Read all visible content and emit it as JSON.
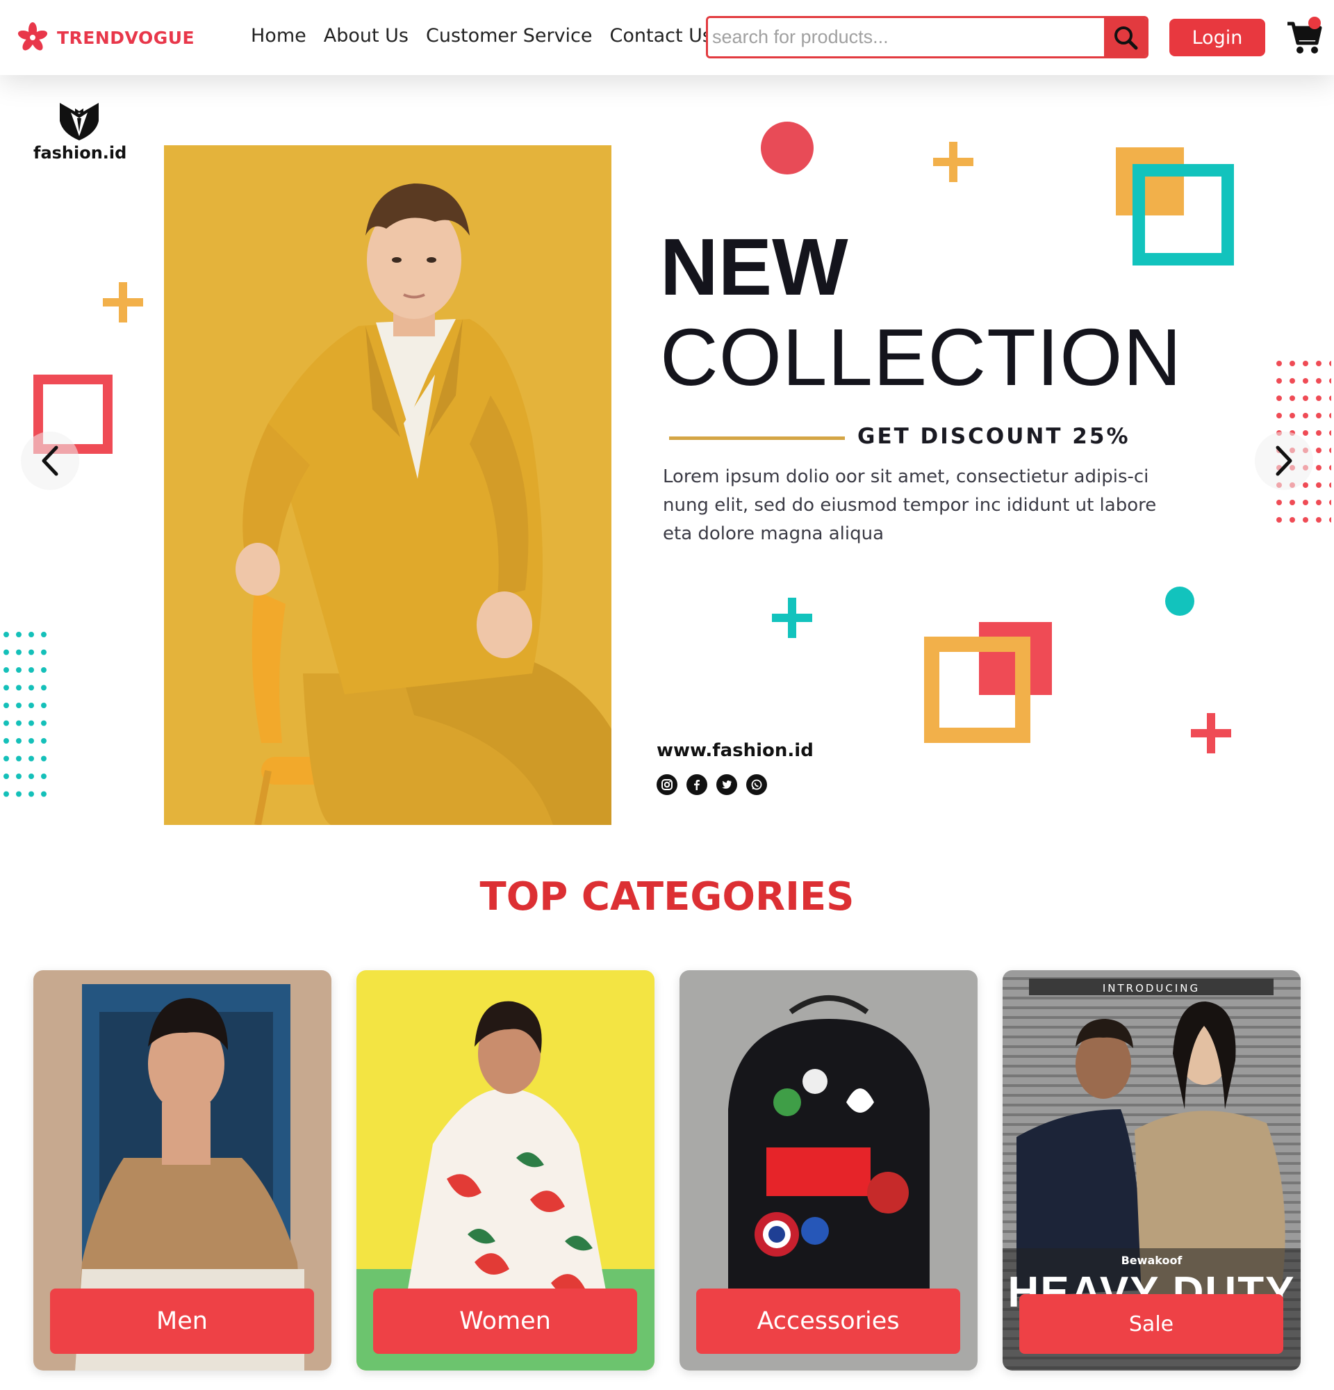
{
  "brand": {
    "name": "TRENDVOGUE"
  },
  "nav": {
    "links": [
      "Home",
      "About Us",
      "Customer Service",
      "Contact Us"
    ]
  },
  "search": {
    "placeholder": "search for products..."
  },
  "login": {
    "label": "Login"
  },
  "hero": {
    "logo_text": "fashion.id",
    "title_line1": "NEW",
    "title_line2": "COLLECTION",
    "discount": "GET DISCOUNT 25%",
    "description": "Lorem ipsum dolio oor sit amet, consectietur adipis-ci nung elit, sed do eiusmod tempor inc ididunt ut labore eta dolore magna aliqua",
    "website": "www.fashion.id",
    "socials": [
      "instagram-icon",
      "facebook-icon",
      "twitter-icon",
      "whatsapp-icon"
    ]
  },
  "categories": {
    "title": "TOP CATEGORIES",
    "items": [
      {
        "label": "Men"
      },
      {
        "label": "Women"
      },
      {
        "label": "Accessories"
      },
      {
        "label": "Sale",
        "banner_top": "INTRODUCING",
        "banner_brand": "Bewakoof",
        "banner_headline": "HEAVY DUTY"
      }
    ]
  },
  "colors": {
    "accent": "#e8383f",
    "gold": "#e4b33b",
    "teal": "#12c3bd",
    "orange": "#f2b04a"
  }
}
